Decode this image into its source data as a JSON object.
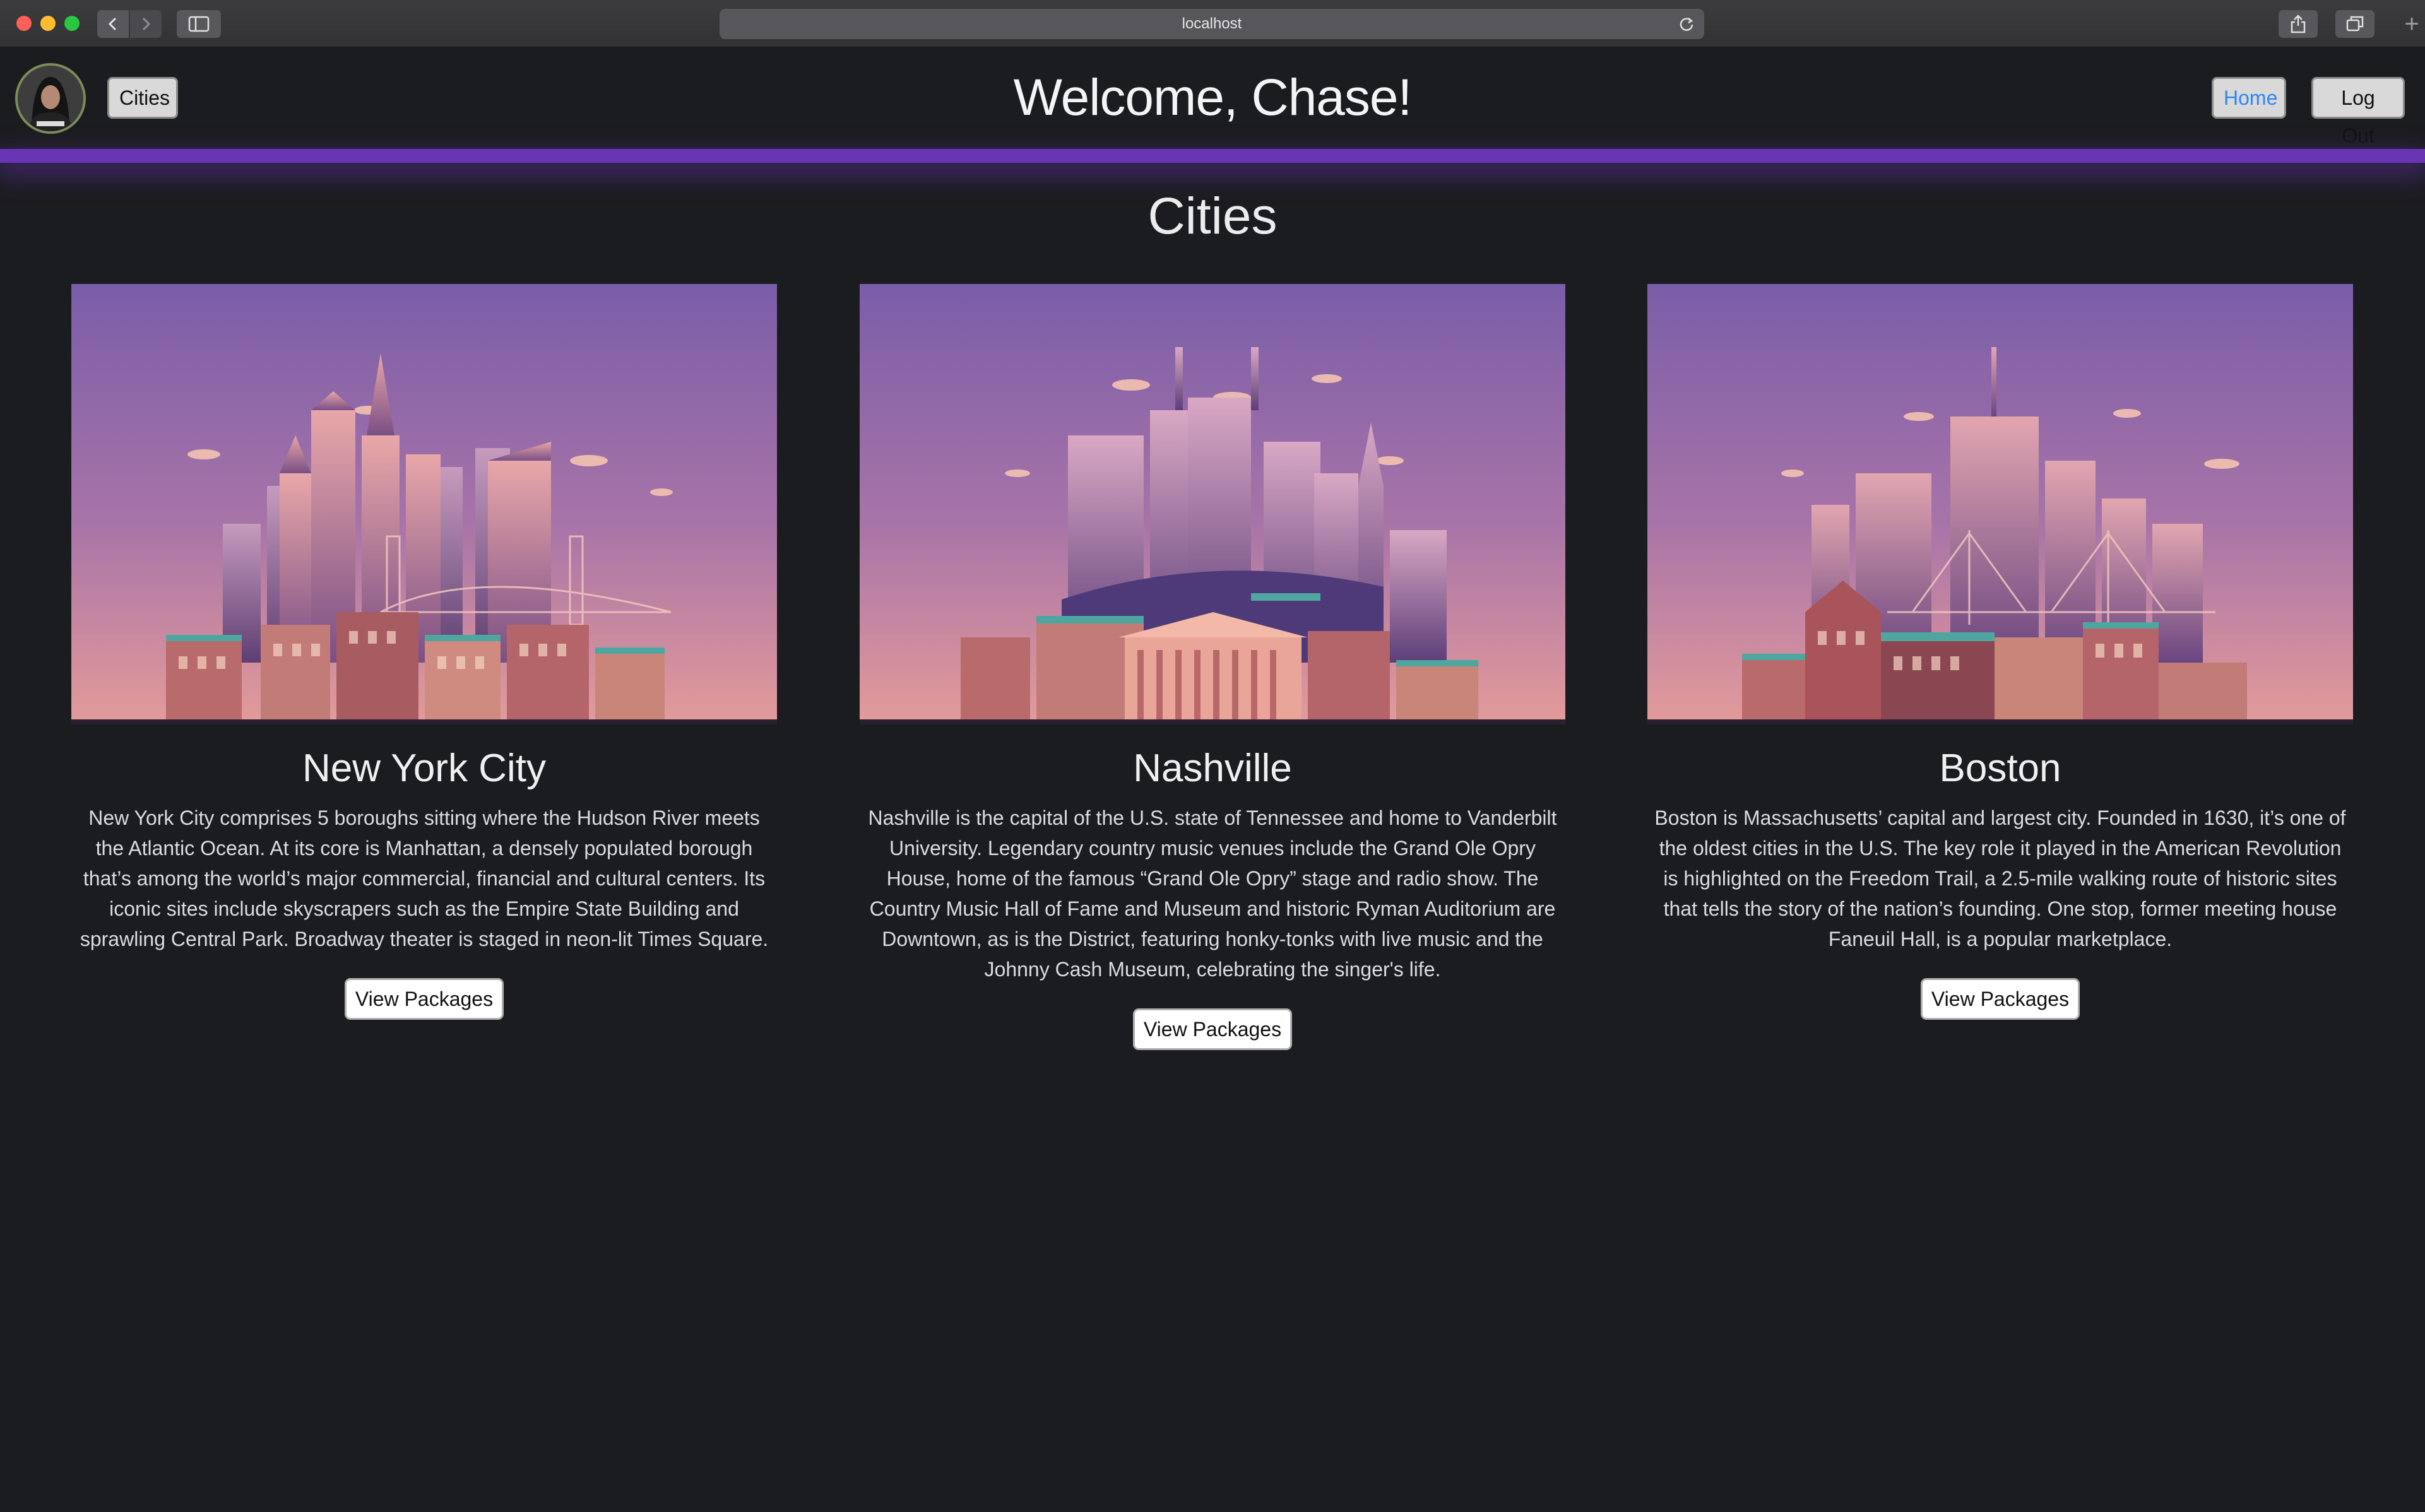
{
  "browser": {
    "url": "localhost"
  },
  "header": {
    "cities_button": "Cities",
    "welcome": "Welcome, Chase!",
    "home_button": "Home",
    "logout_button": "Log Out",
    "accent_color": "#6a35b5"
  },
  "page": {
    "title": "Cities"
  },
  "cities": [
    {
      "name": "New York City",
      "description": "New York City comprises 5 boroughs sitting where the Hudson River meets the Atlantic Ocean. At its core is Manhattan, a densely populated borough that’s among the world’s major commercial, financial and cultural centers. Its iconic sites include skyscrapers such as the Empire State Building and sprawling Central Park. Broadway theater is staged in neon-lit Times Square.",
      "button": "View Packages"
    },
    {
      "name": "Nashville",
      "description": "Nashville is the capital of the U.S. state of Tennessee and home to Vanderbilt University. Legendary country music venues include the Grand Ole Opry House, home of the famous “Grand Ole Opry” stage and radio show. The Country Music Hall of Fame and Museum and historic Ryman Auditorium are Downtown, as is the District, featuring honky-tonks with live music and the Johnny Cash Museum, celebrating the singer's life.",
      "button": "View Packages"
    },
    {
      "name": "Boston",
      "description": "Boston is Massachusetts’ capital and largest city. Founded in 1630, it’s one of the oldest cities in the U.S. The key role it played in the American Revolution is highlighted on the Freedom Trail, a 2.5-mile walking route of historic sites that tells the story of the nation’s founding. One stop, former meeting house Faneuil Hall, is a popular marketplace.",
      "button": "View Packages"
    }
  ]
}
